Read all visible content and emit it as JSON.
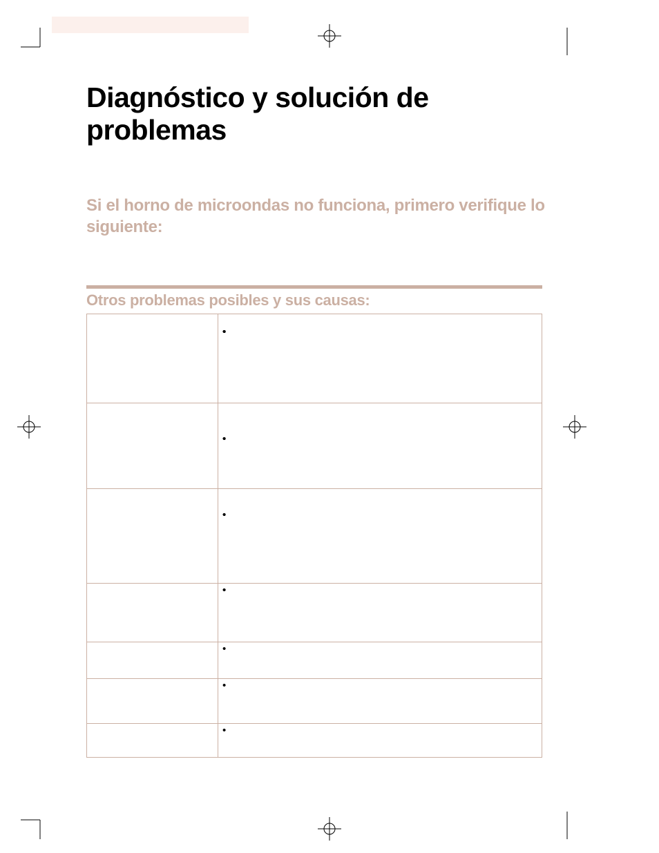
{
  "title": "Diagnóstico y solución de problemas",
  "subtitle": "Si el horno de microondas no funciona, primero verifique lo siguiente:",
  "table_title": "Otros problemas posibles y sus causas:",
  "rows": [
    {
      "problem": "",
      "bullets": [
        "",
        "",
        "",
        "",
        ""
      ]
    },
    {
      "problem": "",
      "bullets": [
        "",
        "",
        ""
      ]
    },
    {
      "problem": "",
      "bullets": [
        "",
        ""
      ]
    },
    {
      "problem": "",
      "bullets": [
        "",
        ""
      ]
    },
    {
      "problem": "",
      "bullets": [
        ""
      ]
    },
    {
      "problem": "",
      "bullets": [
        ""
      ]
    },
    {
      "problem": "",
      "bullets": [
        ""
      ]
    }
  ]
}
